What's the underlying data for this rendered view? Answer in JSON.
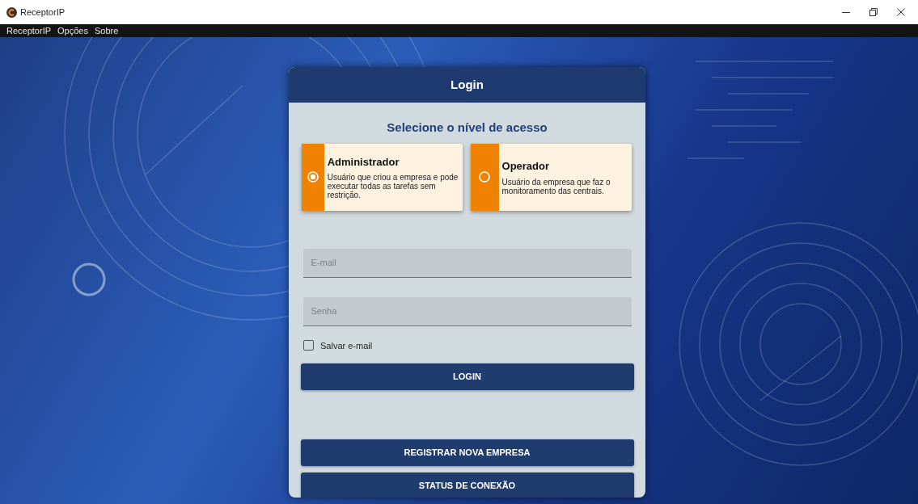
{
  "window": {
    "title": "ReceptorIP"
  },
  "menu": [
    "ReceptorIP",
    "Opções",
    "Sobre"
  ],
  "login": {
    "title": "Login",
    "subtitle": "Selecione o nível de acesso",
    "access_levels": [
      {
        "name": "Administrador",
        "description": "Usuário que criou a empresa e pode executar todas as tarefas sem restrição.",
        "selected": true
      },
      {
        "name": "Operador",
        "description": "Usuário da empresa que faz o monitoramento das centrais.",
        "selected": false
      }
    ],
    "fields": [
      {
        "placeholder": "E-mail"
      },
      {
        "placeholder": "Senha"
      }
    ],
    "save_email": {
      "label": "Salvar e-mail",
      "checked": false
    },
    "login_button": "LOGIN",
    "actions": [
      "REGISTRAR NOVA EMPRESA",
      "STATUS DE CONEXÃO"
    ]
  }
}
